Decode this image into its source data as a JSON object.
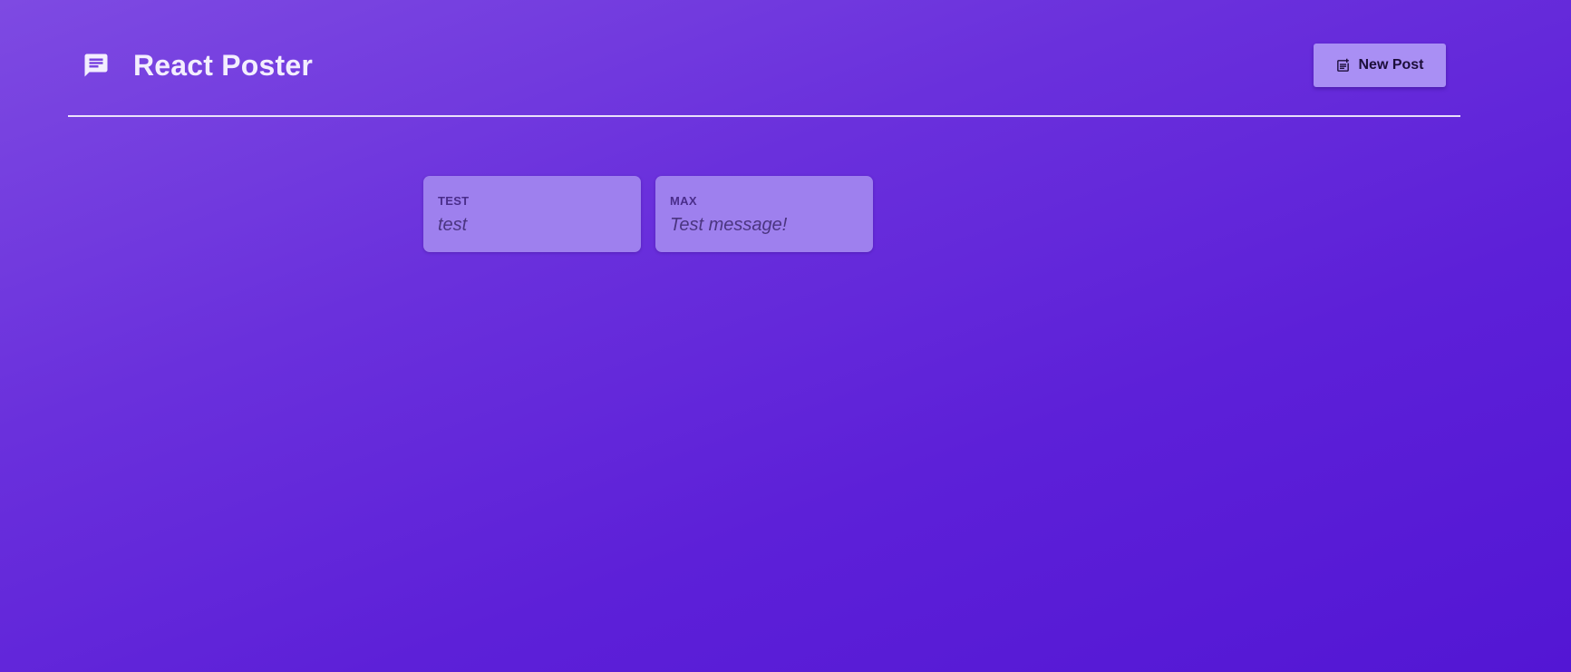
{
  "header": {
    "title": "React Poster",
    "brand_icon": "message-icon",
    "new_post_label": "New Post",
    "new_post_icon": "note-add-icon"
  },
  "posts": [
    {
      "author": "TEST",
      "body": "test"
    },
    {
      "author": "MAX",
      "body": "Test message!"
    }
  ],
  "colors": {
    "background_start": "#7e4ae2",
    "background_end": "#5316d4",
    "button_bg": "#a98ff4",
    "card_bg": "#9e80ee",
    "title_color": "#f3eefe"
  }
}
